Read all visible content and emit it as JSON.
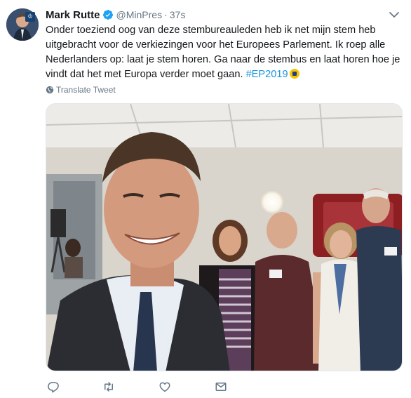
{
  "tweet": {
    "author_name": "Mark Rutte",
    "handle": "@MinPres",
    "separator": "·",
    "time": "37s",
    "text_lines": [
      "Onder toeziend oog van deze stembureauleden heb ik net mijn stem heb",
      "uitgebracht voor de verkiezingen voor het Europees Parlement. Ik roep alle",
      "Nederlanders op: laat je stem horen. Ga naar de stembus en laat horen hoe je",
      "vindt dat het met Europa verder moet gaan."
    ],
    "hashtag": "#EP2019",
    "translate_label": "Translate Tweet"
  },
  "colors": {
    "link": "#1b95e0",
    "secondary_text": "#657786",
    "primary_text": "#14171a",
    "verified_blue": "#1da1f2"
  },
  "icons": {
    "verified": "verified-badge-icon",
    "menu": "chevron-down-icon",
    "translate": "globe-icon",
    "reply": "reply-icon",
    "retweet": "retweet-icon",
    "like": "heart-icon",
    "message": "envelope-icon"
  }
}
